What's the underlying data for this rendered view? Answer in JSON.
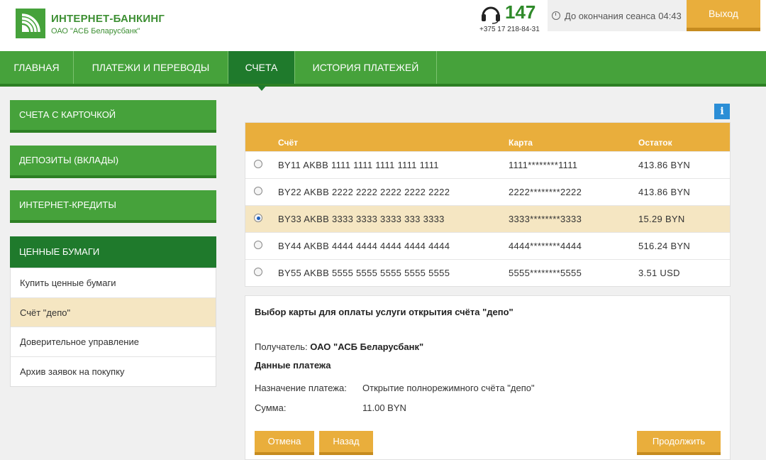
{
  "header": {
    "brand_title": "ИНТЕРНЕТ-БАНКИНГ",
    "brand_subtitle": "ОАО \"АСБ Беларусбанк\"",
    "short_number": "147",
    "phone": "+375 17 218-84-31",
    "session_label": "До окончания сеанса",
    "session_time": "04:43",
    "exit_label": "Выход"
  },
  "nav": {
    "items": [
      {
        "label": "ГЛАВНАЯ"
      },
      {
        "label": "ПЛАТЕЖИ И ПЕРЕВОДЫ"
      },
      {
        "label": "СЧЕТА"
      },
      {
        "label": "ИСТОРИЯ ПЛАТЕЖЕЙ"
      }
    ],
    "active": "СЧЕТА"
  },
  "sidebar": {
    "blocks": [
      {
        "label": "СЧЕТА С КАРТОЧКОЙ"
      },
      {
        "label": "ДЕПОЗИТЫ (ВКЛАДЫ)"
      },
      {
        "label": "ИНТЕРНЕТ-КРЕДИТЫ"
      }
    ],
    "active_block": "ЦЕННЫЕ БУМАГИ",
    "sub_items": [
      {
        "label": "Купить ценные бумаги"
      },
      {
        "label": "Счёт \"депо\""
      },
      {
        "label": "Доверительное управление"
      },
      {
        "label": "Архив заявок на покупку"
      }
    ],
    "selected_sub_item": "Счёт \"депо\""
  },
  "accounts": {
    "headers": {
      "account": "Счёт",
      "card": "Карта",
      "balance": "Остаток"
    },
    "rows": [
      {
        "account": "BY11 AKBB 1111 1111 1111 1111 1111",
        "card": "1111********1111",
        "balance": "413.86 BYN",
        "selected": false
      },
      {
        "account": "BY22 AKBB 2222 2222 2222 2222 2222",
        "card": "2222********2222",
        "balance": "413.86 BYN",
        "selected": false
      },
      {
        "account": "BY33 AKBB 3333 3333 3333 333 3333",
        "card": "3333********3333",
        "balance": "15.29 BYN",
        "selected": true
      },
      {
        "account": "BY44 AKBB 4444 4444 4444 4444 4444",
        "card": "4444********4444",
        "balance": "516.24 BYN",
        "selected": false
      },
      {
        "account": "BY55 AKBB 5555 5555 5555 5555 5555",
        "card": "5555********5555",
        "balance": "3.51 USD",
        "selected": false
      }
    ]
  },
  "payment": {
    "title": "Выбор карты для оплаты услуги открытия счёта \"депо\"",
    "recipient_label": "Получатель:",
    "recipient_value": "ОАО \"АСБ Беларусбанк\"",
    "data_heading": "Данные платежа",
    "purpose_label": "Назначение платежа:",
    "purpose_value": "Открытие полнорежимного счёта \"депо\"",
    "sum_label": "Сумма:",
    "sum_value": "11.00 BYN",
    "cancel_label": "Отмена",
    "back_label": "Назад",
    "continue_label": "Продолжить"
  },
  "info_icon_text": "i",
  "colors": {
    "green": "#46a23b",
    "dark_green": "#1f7a2c",
    "orange": "#e9ae3c",
    "highlight": "#f5e6c2",
    "info_blue": "#2b8ed6"
  }
}
